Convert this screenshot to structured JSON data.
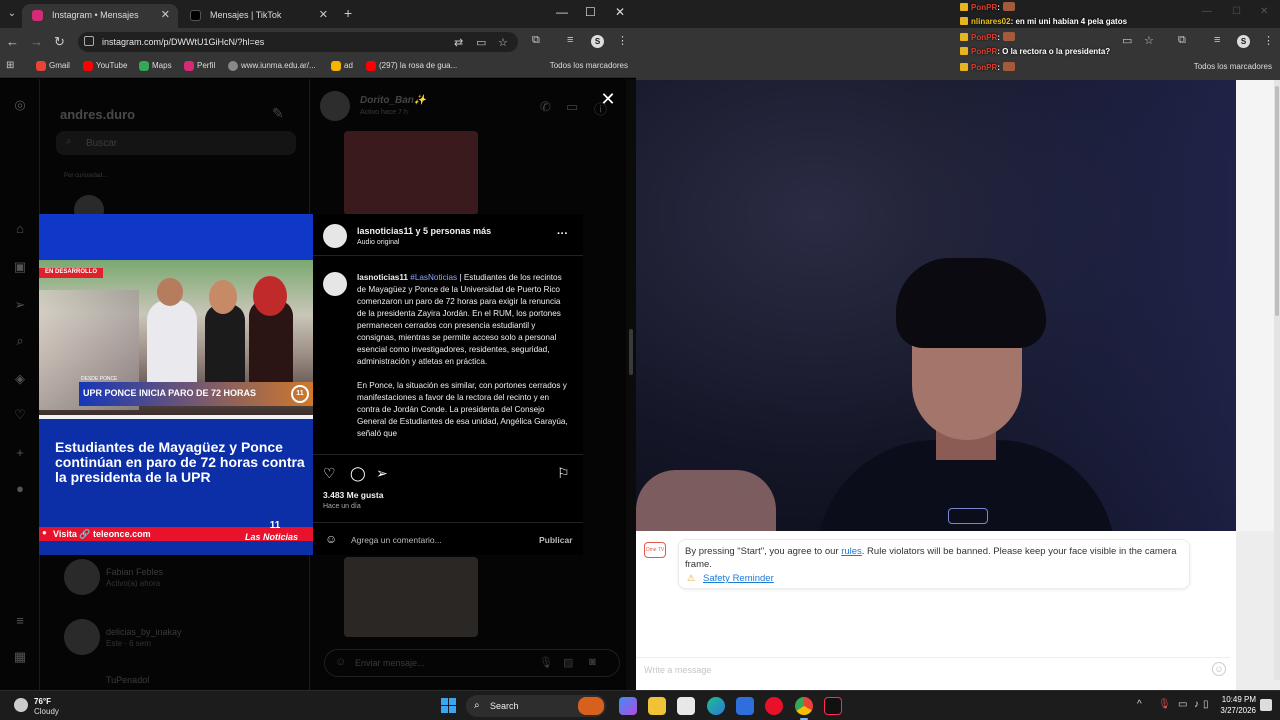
{
  "left_browser": {
    "tabs": [
      {
        "title": "Instagram • Mensajes",
        "favicon_color": "#d62976",
        "active": true
      },
      {
        "title": "Mensajes | TikTok",
        "favicon_color": "#000000",
        "active": false
      }
    ],
    "url": "instagram.com/p/DWWtU1GiHcN/?hl=es",
    "bookmarks": [
      {
        "label": "Gmail",
        "color": "#ea4335"
      },
      {
        "label": "YouTube",
        "color": "#ff0000"
      },
      {
        "label": "Maps",
        "color": "#34a853"
      },
      {
        "label": "Perfil",
        "color": "#d62976"
      },
      {
        "label": "www.iunma.edu.ar/...",
        "color": "#888888"
      },
      {
        "label": "ad",
        "color": "#f4b400"
      },
      {
        "label": "(297) la rosa de gua...",
        "color": "#ff0000"
      }
    ],
    "all_bookmarks": "Todos los marcadores"
  },
  "instagram": {
    "username": "andres.duro",
    "search_placeholder": "Buscar",
    "thread_name": "Dorito_Ban✨",
    "thread_status": "Activo hace 7 h",
    "message_placeholder": "Enviar mensaje...",
    "dim_chats": [
      {
        "name": "Fabian Febles",
        "sub": "Activo(a) ahora"
      },
      {
        "name": "delicias_by_inakay",
        "sub": "Este · 6 sem"
      },
      {
        "name": "TuPenadol",
        "sub": ""
      }
    ],
    "note_label": "Por curiosidad..."
  },
  "post": {
    "author_line": "lasnoticias11 y 5 personas más",
    "audio": "Audio original",
    "tag_dev": "EN DESARROLLO",
    "tag_ponce": "DESDE PONCE",
    "lower_third": "UPR PONCE INICIA PARO DE 72 HORAS",
    "channel_num": "11",
    "headline": "Estudiantes de Mayagüez y Ponce continúan en paro de 72 horas contra la presidenta de la UPR",
    "footer_site": "Visita 🔗 teleonce.com",
    "brand": "Las Noticias",
    "caption_user": "lasnoticias11",
    "caption_hashtag": "#LasNoticias",
    "caption_p1": " | Estudiantes de los recintos de Mayagüez y Ponce de la Universidad de Puerto Rico comenzaron un paro de 72 horas para exigir la renuncia de la presidenta Zayira Jordán. En el RUM, los portones permanecen cerrados con presencia estudiantil y consignas, mientras se permite acceso solo a personal esencial como investigadores, residentes, seguridad, administración y atletas en práctica.",
    "caption_p2": "En Ponce, la situación es similar, con portones cerrados y manifestaciones a favor de la rectora del recinto y en contra de Jordán Conde. La presidenta del Consejo General de Estudiantes de esa unidad, Angélica Garayúa, señaló que",
    "likes": "3.483 Me gusta",
    "time_ago": "Hace un día",
    "comment_placeholder": "Agrega un comentario...",
    "publish": "Publicar"
  },
  "right_browser": {
    "all_bookmarks": "Todos los marcadores",
    "chat_overlay": [
      {
        "user": "PonPR",
        "user_color": "red",
        "text": ":"
      },
      {
        "user": "nlinares02",
        "user_color": "gold",
        "text": ": en mi uni habían 4 pela gatos"
      },
      {
        "user": "PonPR",
        "user_color": "red",
        "text": ":"
      },
      {
        "user": "PonPR",
        "user_color": "red",
        "text": ": O la rectora o la presidenta?"
      },
      {
        "user": "PonPR",
        "user_color": "red",
        "text": ":"
      }
    ],
    "sys_logo": "Ome TV",
    "sys_before": "By pressing \"Start\", you agree to our ",
    "sys_link": "rules",
    "sys_after": ". Rule violators will be banned. Please keep your face visible in the camera frame.",
    "safety": "Safety Reminder",
    "message_placeholder": "Write a message"
  },
  "taskbar": {
    "temp": "76°F",
    "condition": "Cloudy",
    "search": "Search",
    "time": "10:49 PM",
    "date": "3/27/2026"
  }
}
